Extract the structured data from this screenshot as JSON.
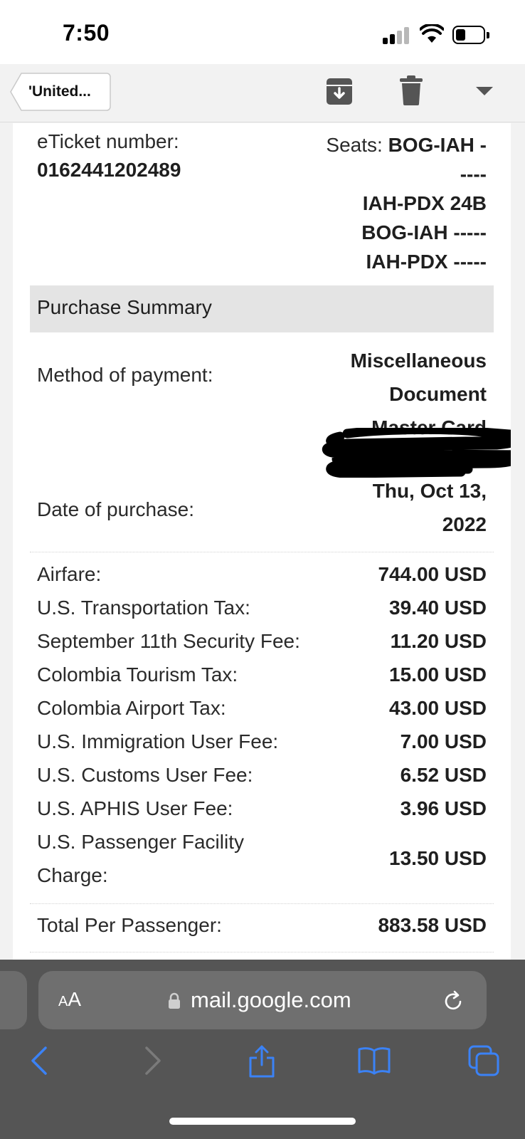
{
  "status_bar": {
    "time": "7:50"
  },
  "toolbar": {
    "back_label": "'United..."
  },
  "ticket": {
    "eticket_label": "eTicket number:",
    "eticket_number": "0162441202489",
    "seats_prefix": "Seats: ",
    "seats_lines": [
      "BOG-IAH -",
      "----",
      "IAH-PDX 24B",
      "BOG-IAH -----",
      "IAH-PDX -----"
    ]
  },
  "summary": {
    "title": "Purchase Summary",
    "payment_label": "Method of payment:",
    "payment_lines": [
      "Miscellaneous",
      "Document",
      "Master Card"
    ],
    "date_label": "Date of purchase:",
    "date_lines": [
      "Thu, Oct 13,",
      "2022"
    ]
  },
  "fares": [
    {
      "label": "Airfare:",
      "value": "744.00 USD"
    },
    {
      "label": "U.S. Transportation Tax:",
      "value": "39.40 USD"
    },
    {
      "label": "September 11th Security Fee:",
      "value": "11.20 USD"
    },
    {
      "label": "Colombia Tourism Tax:",
      "value": "15.00 USD"
    },
    {
      "label": "Colombia Airport Tax:",
      "value": "43.00 USD"
    },
    {
      "label": "U.S. Immigration User Fee:",
      "value": "7.00 USD"
    },
    {
      "label": "U.S. Customs User Fee:",
      "value": "6.52 USD"
    },
    {
      "label": "U.S. APHIS User Fee:",
      "value": "3.96 USD"
    },
    {
      "label": "U.S. Passenger Facility Charge:",
      "value": "13.50 USD"
    }
  ],
  "total": {
    "label": "Total Per Passenger:",
    "value": "883.58 USD"
  },
  "browser": {
    "aa_big": "A",
    "aa_small": "A",
    "url": "mail.google.com"
  },
  "colors": {
    "accent": "#3b82f6",
    "browser_chrome": "#555555"
  }
}
